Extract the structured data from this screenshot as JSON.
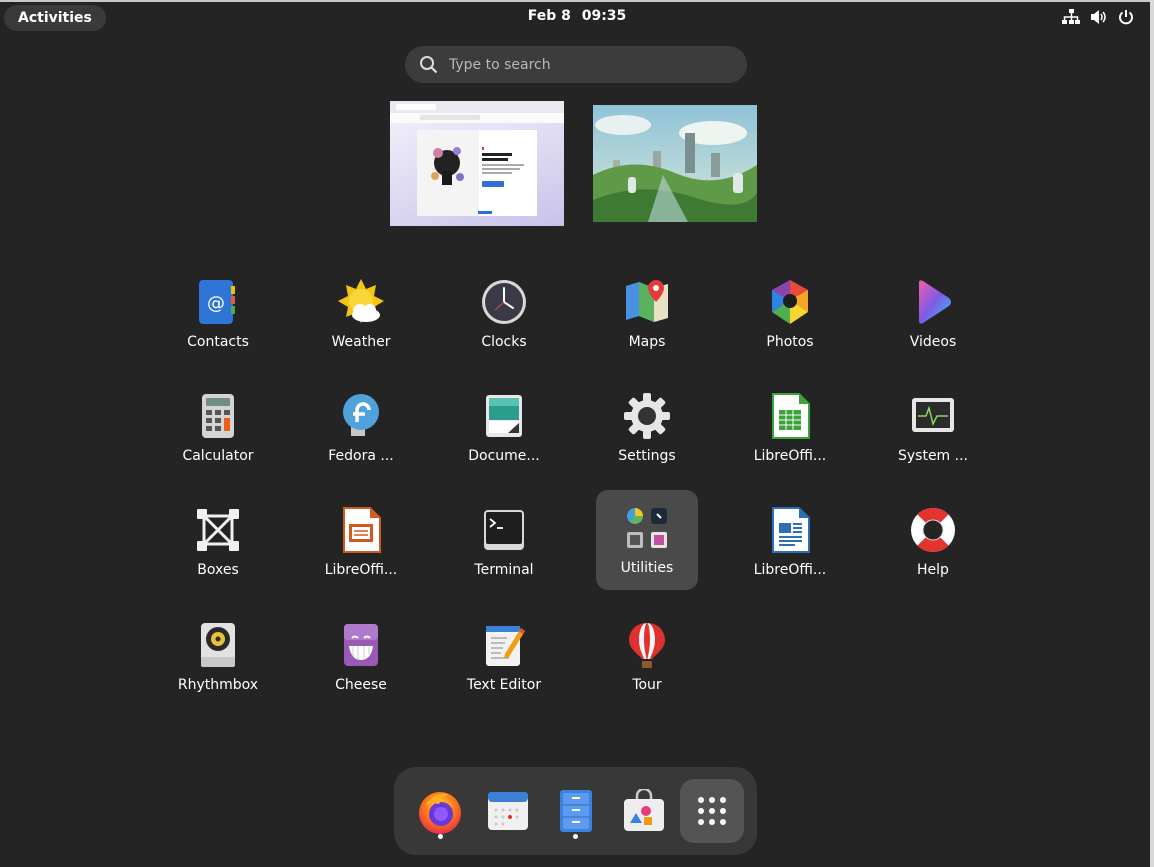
{
  "topbar": {
    "activities_label": "Activities",
    "date": "Feb 8",
    "time": "09:35"
  },
  "search": {
    "placeholder": "Type to search"
  },
  "apps": [
    {
      "label": "Contacts"
    },
    {
      "label": "Weather"
    },
    {
      "label": "Clocks"
    },
    {
      "label": "Maps"
    },
    {
      "label": "Photos"
    },
    {
      "label": "Videos"
    },
    {
      "label": "Calculator"
    },
    {
      "label": "Fedora ..."
    },
    {
      "label": "Docume..."
    },
    {
      "label": "Settings"
    },
    {
      "label": "LibreOffi..."
    },
    {
      "label": "System ..."
    },
    {
      "label": "Boxes"
    },
    {
      "label": "LibreOffi..."
    },
    {
      "label": "Terminal"
    },
    {
      "label": "Utilities"
    },
    {
      "label": "LibreOffi..."
    },
    {
      "label": "Help"
    },
    {
      "label": "Rhythmbox"
    },
    {
      "label": "Cheese"
    },
    {
      "label": "Text Editor"
    },
    {
      "label": "Tour"
    }
  ],
  "dock": {
    "items": [
      "firefox-icon",
      "calendar-icon",
      "files-icon",
      "software-icon",
      "app-grid-icon"
    ]
  },
  "colors": {
    "background": "#242424",
    "selected": "#4a4a4a",
    "dock": "#383838"
  }
}
